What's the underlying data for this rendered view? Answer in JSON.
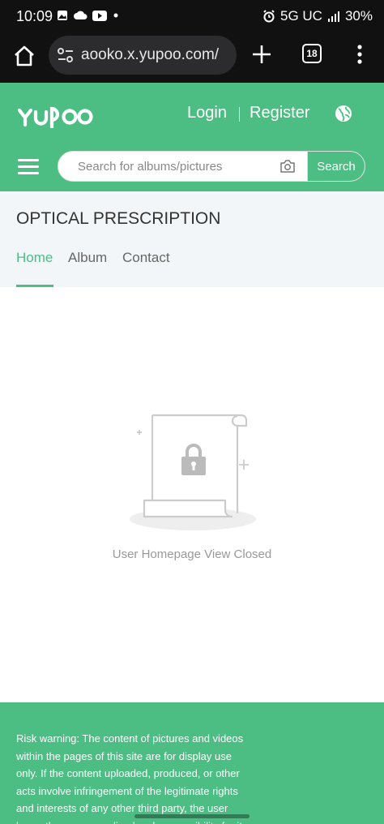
{
  "status_bar": {
    "time": "10:09",
    "network": "5G UC",
    "battery": "30%"
  },
  "browser": {
    "url": "aooko.x.yupoo.com/",
    "tab_count": "18"
  },
  "header": {
    "logo_text": "YUPOO",
    "login": "Login",
    "register": "Register",
    "search_placeholder": "Search for albums/pictures",
    "search_button": "Search"
  },
  "store": {
    "title": "OPTICAL PRESCRIPTION",
    "tabs": [
      "Home",
      "Album",
      "Contact"
    ],
    "active_tab": "Home"
  },
  "content": {
    "closed_message": "User Homepage View Closed"
  },
  "footer": {
    "risk_warning": "Risk warning: The content of pictures and videos within the pages of this site are for display use only. If the content uploaded, produced, or other acts involve infringement of the legitimate rights and interests of any other third party, the user bears the corresponding legal responsibility for it"
  },
  "colors": {
    "brand_green": "#4cbe84",
    "browser_dark": "#111111"
  }
}
